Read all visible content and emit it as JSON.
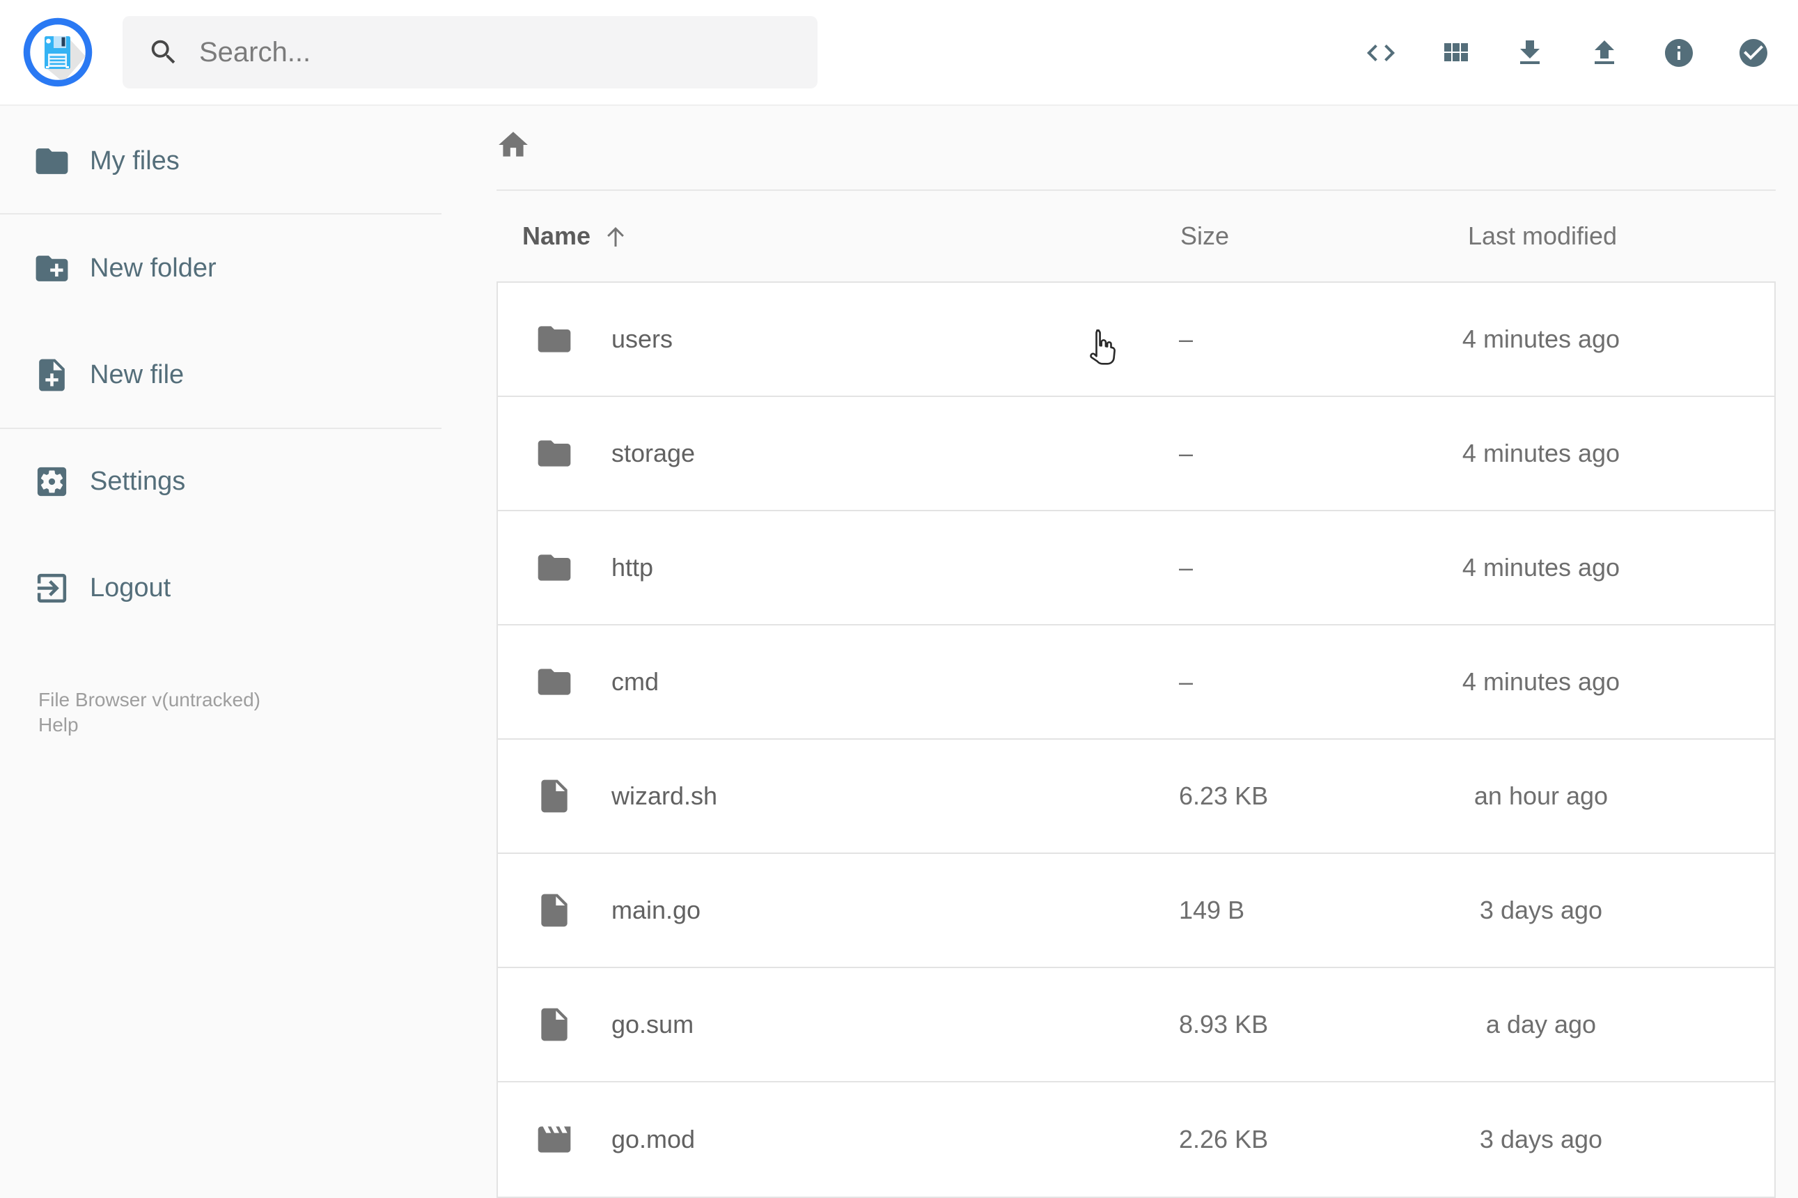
{
  "topbar": {
    "logo_icon": "floppy-disk-icon",
    "search_placeholder": "Search...",
    "action_icons": [
      "code-icon",
      "grid-view-icon",
      "download-icon",
      "upload-icon",
      "info-icon",
      "check-circle-icon"
    ]
  },
  "sidebar": {
    "items": [
      {
        "label": "My files",
        "icon": "folder-icon"
      },
      {
        "label": "New folder",
        "icon": "new-folder-icon"
      },
      {
        "label": "New file",
        "icon": "new-file-icon"
      },
      {
        "label": "Settings",
        "icon": "settings-icon"
      },
      {
        "label": "Logout",
        "icon": "logout-icon"
      }
    ],
    "footer": {
      "version": "File Browser v(untracked)",
      "help": "Help"
    }
  },
  "main": {
    "breadcrumb_icon": "home-icon",
    "table": {
      "headers": {
        "name": "Name",
        "size": "Size",
        "modified": "Last modified"
      },
      "sort_icon": "arrow-up-icon"
    },
    "rows": [
      {
        "name": "users",
        "icon": "folder-icon",
        "size": "–",
        "modified": "4 minutes ago"
      },
      {
        "name": "storage",
        "icon": "folder-icon",
        "size": "–",
        "modified": "4 minutes ago"
      },
      {
        "name": "http",
        "icon": "folder-icon",
        "size": "–",
        "modified": "4 minutes ago"
      },
      {
        "name": "cmd",
        "icon": "folder-icon",
        "size": "–",
        "modified": "4 minutes ago"
      },
      {
        "name": "wizard.sh",
        "icon": "file-icon",
        "size": "6.23 KB",
        "modified": "an hour ago"
      },
      {
        "name": "main.go",
        "icon": "file-icon",
        "size": "149 B",
        "modified": "3 days ago"
      },
      {
        "name": "go.sum",
        "icon": "file-icon",
        "size": "8.93 KB",
        "modified": "a day ago"
      },
      {
        "name": "go.mod",
        "icon": "movie-icon",
        "size": "2.26 KB",
        "modified": "3 days ago"
      }
    ]
  },
  "colors": {
    "accent_slate": "#546e7a",
    "logo_blue": "#2a79f3",
    "logo_lightblue": "#34b3f4",
    "icon_gray": "#757575",
    "text_gray": "#616161",
    "page_bg": "#fafafa",
    "row_bg": "#ffffff",
    "border": "#e3e3e3"
  }
}
